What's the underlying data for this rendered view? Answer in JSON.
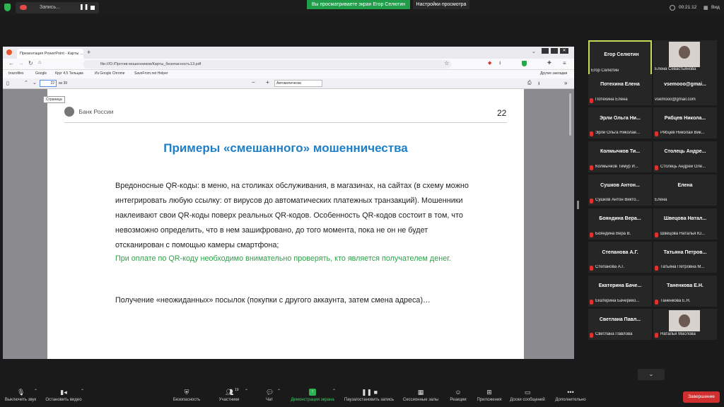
{
  "topbar": {
    "record_label": "Запись...",
    "share_banner": "Вы просматриваете экран Егор Селютин",
    "view_options": "Настройки просмотра",
    "timer": "00:21:12",
    "view_label": "Вид"
  },
  "browser": {
    "tab_title": "Презентация PowerPoint - Карты ...",
    "url": "file:///D:/Против мошенников/Карты_безопасность13.pdf",
    "bookmarks": [
      "brazofiles",
      "Google",
      "Круг 4,5 Тельцам",
      "Из Google Chrome",
      "SaveFrom.net Helper"
    ],
    "other_bookmarks": "Другие закладки",
    "page_input": "22",
    "page_total": "из 39",
    "page_tooltip": "Страница",
    "zoom": "Автоматически"
  },
  "slide": {
    "logo_text": "Банк России",
    "page_number": "22",
    "title": "Примеры «смешанного» мошенничества",
    "paragraph1": "Вредоносные QR-коды: в меню, на столиках обслуживания, в магазинах, на сайтах (в схему можно интегрировать любую ссылку: от вирусов до автоматических платежных транзакций). Мошенники наклеивают свои QR-коды поверх реальных QR-кодов. Особенность QR-кодов состоит в том, что невозможно определить, что в нем зашифровано, до того момента, пока не он не будет отсканирован с помощью камеры смартфона;",
    "paragraph2": "При оплате по QR-коду необходимо внимательно проверять, кто является получателем денег.",
    "paragraph3": "Получение «неожиданных» посылок (покупки с другого аккаунта, затем смена адреса)…"
  },
  "gallery": {
    "tiles": [
      {
        "name": "Егор Селютин",
        "sub": "Егор Селютин",
        "muted": false,
        "active": true
      },
      {
        "name": "",
        "sub": "Елена Севастьянова",
        "muted": false,
        "video": true
      },
      {
        "name": "Потехина Елена",
        "sub": "Потехина Елена",
        "muted": true
      },
      {
        "name": "vsemooo@gmai...",
        "sub": "vsemooo@gmail.com",
        "muted": false
      },
      {
        "name": "Эрли Ольга Ни...",
        "sub": "Эрли Ольга Николае...",
        "muted": true
      },
      {
        "name": "Рябцев Никола...",
        "sub": "Рябцев Николай Вик...",
        "muted": true
      },
      {
        "name": "Колмычков Ти...",
        "sub": "Колмычков Тимур И...",
        "muted": true
      },
      {
        "name": "Столець Андре...",
        "sub": "Столець Андрей Оле...",
        "muted": true
      },
      {
        "name": "Сушков Антон...",
        "sub": "Сушков Антон Викто...",
        "muted": true
      },
      {
        "name": "Елена",
        "sub": "Елена",
        "muted": false
      },
      {
        "name": "Бояндина Вера...",
        "sub": "Бояндина Вера В.",
        "muted": true
      },
      {
        "name": "Швецова Натал...",
        "sub": "Швецова Наталья Ю...",
        "muted": true
      },
      {
        "name": "Степанова А.Г.",
        "sub": "Степанова А.Г.",
        "muted": true
      },
      {
        "name": "Татьяна Петров...",
        "sub": "Татьяна Петровна М...",
        "muted": true
      },
      {
        "name": "Екатерина Баче...",
        "sub": "Екатерина Бачерико...",
        "muted": true
      },
      {
        "name": "Таненкова Е.Н.",
        "sub": "Таненкова Е.Н.",
        "muted": true
      },
      {
        "name": "Светлана Павл...",
        "sub": "Светлана Павлова",
        "muted": true
      },
      {
        "name": "",
        "sub": "Наталья Маслова",
        "muted": true,
        "video": true
      }
    ]
  },
  "toolbar": {
    "mute": "Выключить звук",
    "video": "Остановить видео",
    "security": "Безопасность",
    "participants": "Участники",
    "participants_count": "19",
    "chat": "Чат",
    "share": "Демонстрация экрана",
    "record": "Пауза/остановить запись",
    "breakout": "Сессионные залы",
    "reactions": "Реакции",
    "apps": "Приложения",
    "whiteboard": "Доски сообщений",
    "more": "Дополнительно",
    "end": "Завершение"
  },
  "colors": {
    "accent_green": "#1f9d49",
    "title_blue": "#1f7fc6",
    "text_green": "#2ea04a",
    "end_red": "#d12f2f",
    "active_border": "#c8d95a"
  }
}
